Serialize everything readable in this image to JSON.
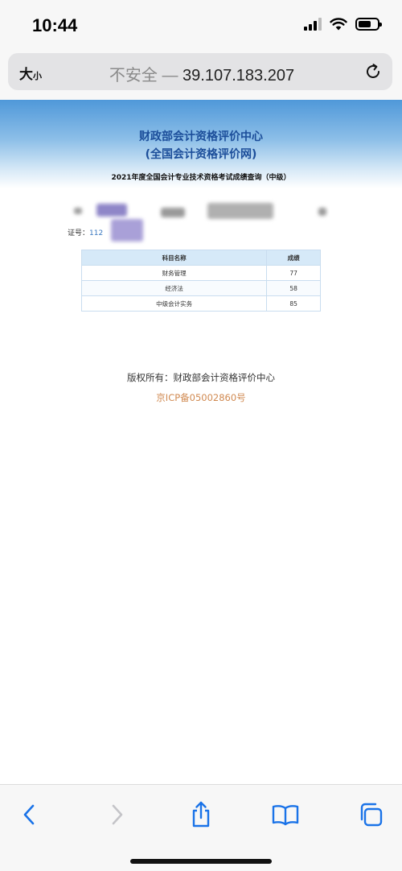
{
  "status_bar": {
    "time": "10:44"
  },
  "browser": {
    "text_size_big": "大",
    "text_size_small": "小",
    "insecure_label": "不安全 —",
    "host": "39.107.183.207"
  },
  "page": {
    "org_name": "财政部会计资格评价中心",
    "org_site": "(全国会计资格评价网)",
    "exam_title": "2021年度全国会计专业技术资格考试成绩查询（中级）",
    "cert_label": "证号：",
    "cert_partial": "112",
    "table": {
      "headers": [
        "科目名称",
        "成绩"
      ],
      "rows": [
        {
          "subject": "财务管理",
          "score": "77"
        },
        {
          "subject": "经济法",
          "score": "58"
        },
        {
          "subject": "中级会计实务",
          "score": "85"
        }
      ]
    },
    "copyright": "版权所有：财政部会计资格评价中心",
    "icp": "京ICP备05002860号"
  },
  "colors": {
    "accent": "#1c4e9a",
    "link": "#3a78c0",
    "icp": "#d08950",
    "toolbar_icon": "#1a73e8"
  },
  "icons": {
    "reload": "reload-icon",
    "back": "chevron-left-icon",
    "forward": "chevron-right-icon",
    "share": "share-icon",
    "bookmarks": "book-icon",
    "tabs": "tabs-icon"
  }
}
